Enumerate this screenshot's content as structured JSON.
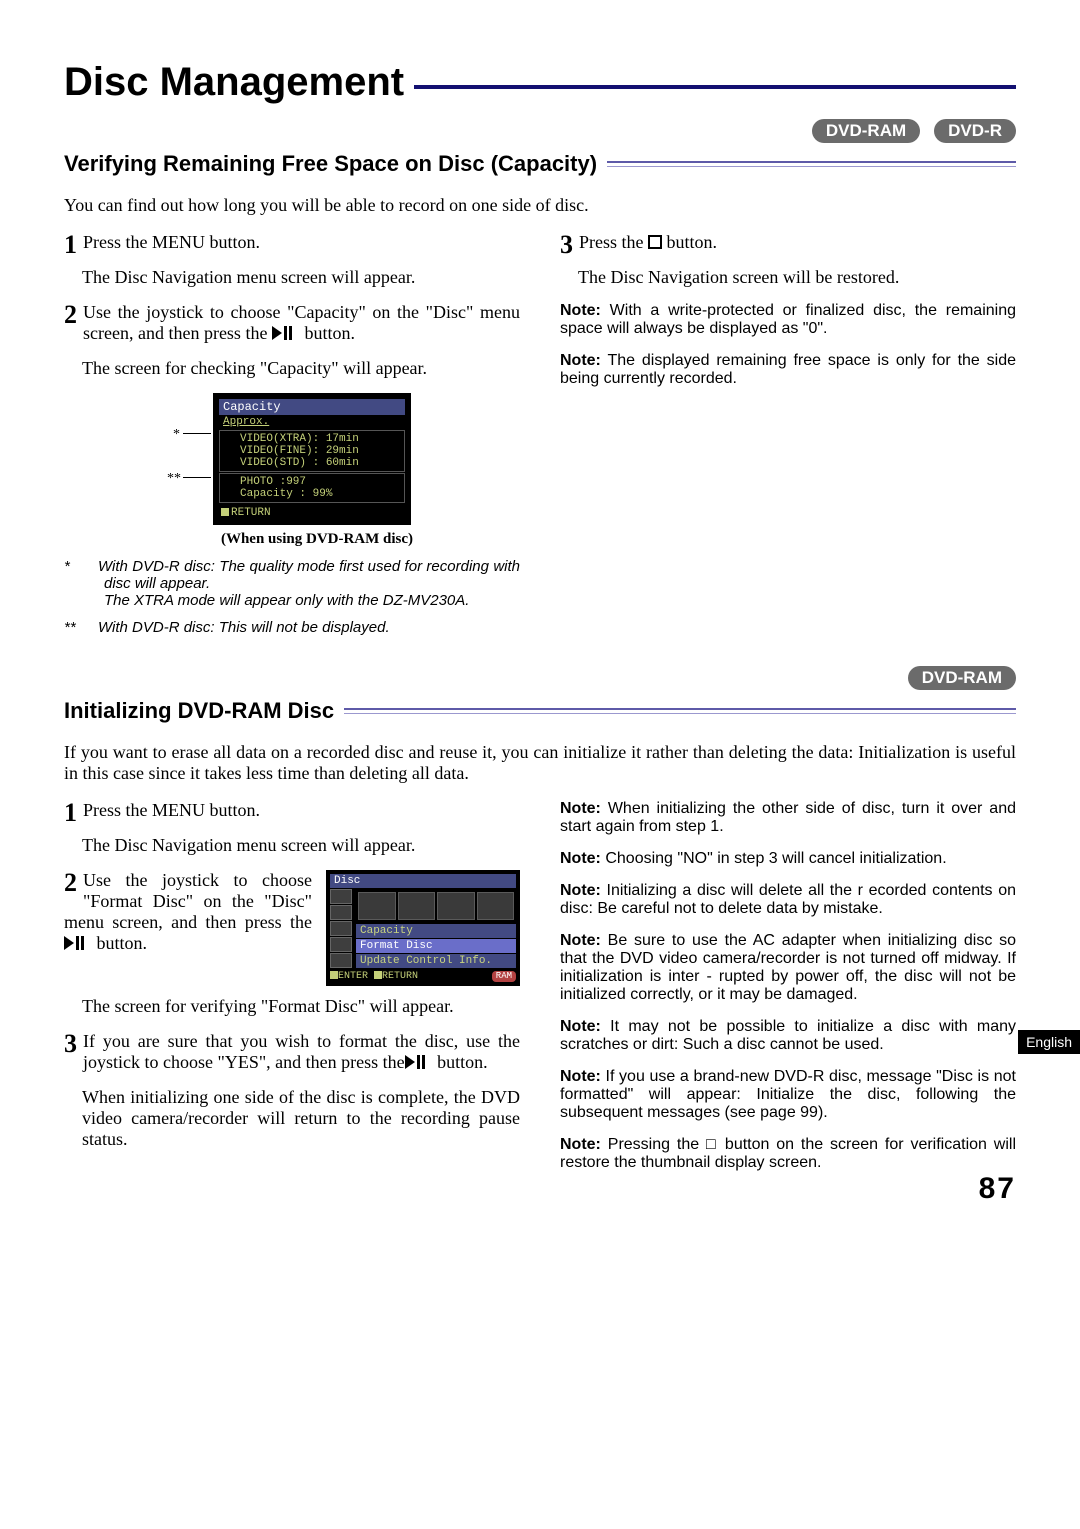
{
  "page_title": "Disc Management",
  "badges": {
    "dvd_ram": "DVD-RAM",
    "dvd_r": "DVD-R"
  },
  "section1": {
    "heading": "Verifying Remaining Free Space on Disc (Capacity)",
    "intro": "You can find out how long you will be able to record on one side of disc.",
    "step1_num": "1",
    "step1_a": "Press the MENU button.",
    "step1_b": "The Disc Navigation menu screen will appear.",
    "step2_num": "2",
    "step2_a_pre": "Use the joystick to choose \"Capacity\" on the \"Disc\" menu screen, and then press the ",
    "step2_a_post": " button.",
    "step2_b": "The screen for checking \"Capacity\" will appear.",
    "step3_num": "3",
    "step3_a_pre": "Press the ",
    "step3_a_post": " button.",
    "step3_b": "The Disc Navigation screen will be restored.",
    "note1_label": "Note:",
    "note1": "With a write-protected or finalized disc, the remaining space will always be displayed as \"0\".",
    "note2_label": "Note:",
    "note2": "The displayed remaining free space is only for the side being currently recorded.",
    "footnote1_mark": "*",
    "footnote1": "With DVD-R disc: The quality mode first used for recording with disc will appear.\nThe XTRA mode will appear only with the DZ-MV230A.",
    "footnote2_mark": "**",
    "footnote2": "With DVD-R disc: This will not be displayed.",
    "capacity_caption": "(When using DVD-RAM disc)",
    "capacity_screen": {
      "title": "Capacity",
      "sub": "Approx.",
      "rows": [
        "VIDEO(XTRA): 17min",
        "VIDEO(FINE): 29min",
        "VIDEO(STD) : 60min",
        "PHOTO      :997",
        "Capacity   : 99%"
      ],
      "return": "RETURN"
    },
    "ast1": "*",
    "ast2": "**"
  },
  "section2": {
    "heading": "Initializing DVD-RAM Disc",
    "intro": "If you want to erase all data on a recorded disc and reuse it, you can initialize it rather than deleting the data: Initialization is useful in this case since it takes less time than deleting all data.",
    "step1_num": "1",
    "step1_a": "Press the MENU button.",
    "step1_b": "The Disc Navigation menu screen will appear.",
    "step2_num": "2",
    "step2_a_pre": "Use the joystick to choose \"Format Disc\" on the \"Disc\" menu screen, and then press the",
    "step2_a_post": " button.",
    "step2_b": "The screen for verifying \"Format Disc\" will appear.",
    "step3_num": "3",
    "step3_a_pre": "If you are sure that you wish to format the disc, use the joystick to choose \"YES\", and then press the",
    "step3_a_post": " button.",
    "step3_b": "When initializing one side of the disc is complete, the DVD video camera/recorder will return to the recording pause status.",
    "disc_screen": {
      "title": "Disc",
      "items": [
        "Capacity",
        "Format Disc",
        "Update Control Info."
      ],
      "enter": "ENTER",
      "return": "RETURN",
      "ram": "RAM"
    },
    "note_label": "Note:",
    "notes": [
      "When initializing the other side of disc, turn it over and start again from step 1.",
      "Choosing \"NO\" in step 3 will cancel initialization.",
      "Initializing a disc will delete all the r ecorded contents on disc: Be careful not to delete data by mistake.",
      "Be sure to use the AC adapter when initializing disc so that the DVD video camera/recorder is not turned off midway. If initialization is inter - rupted by power off, the disc will not be initialized correctly, or it may be damaged.",
      "It may not be possible to initialize a disc with many scratches or dirt: Such a disc cannot be used.",
      "If you use a brand-new DVD-R disc, message \"Disc is not formatted\" will appear: Initialize the disc, following the subsequent messages (see page 99).",
      "Pressing the □ button on the screen for verification will restore the thumbnail display screen."
    ]
  },
  "side_tab": "English",
  "page_number": "87"
}
